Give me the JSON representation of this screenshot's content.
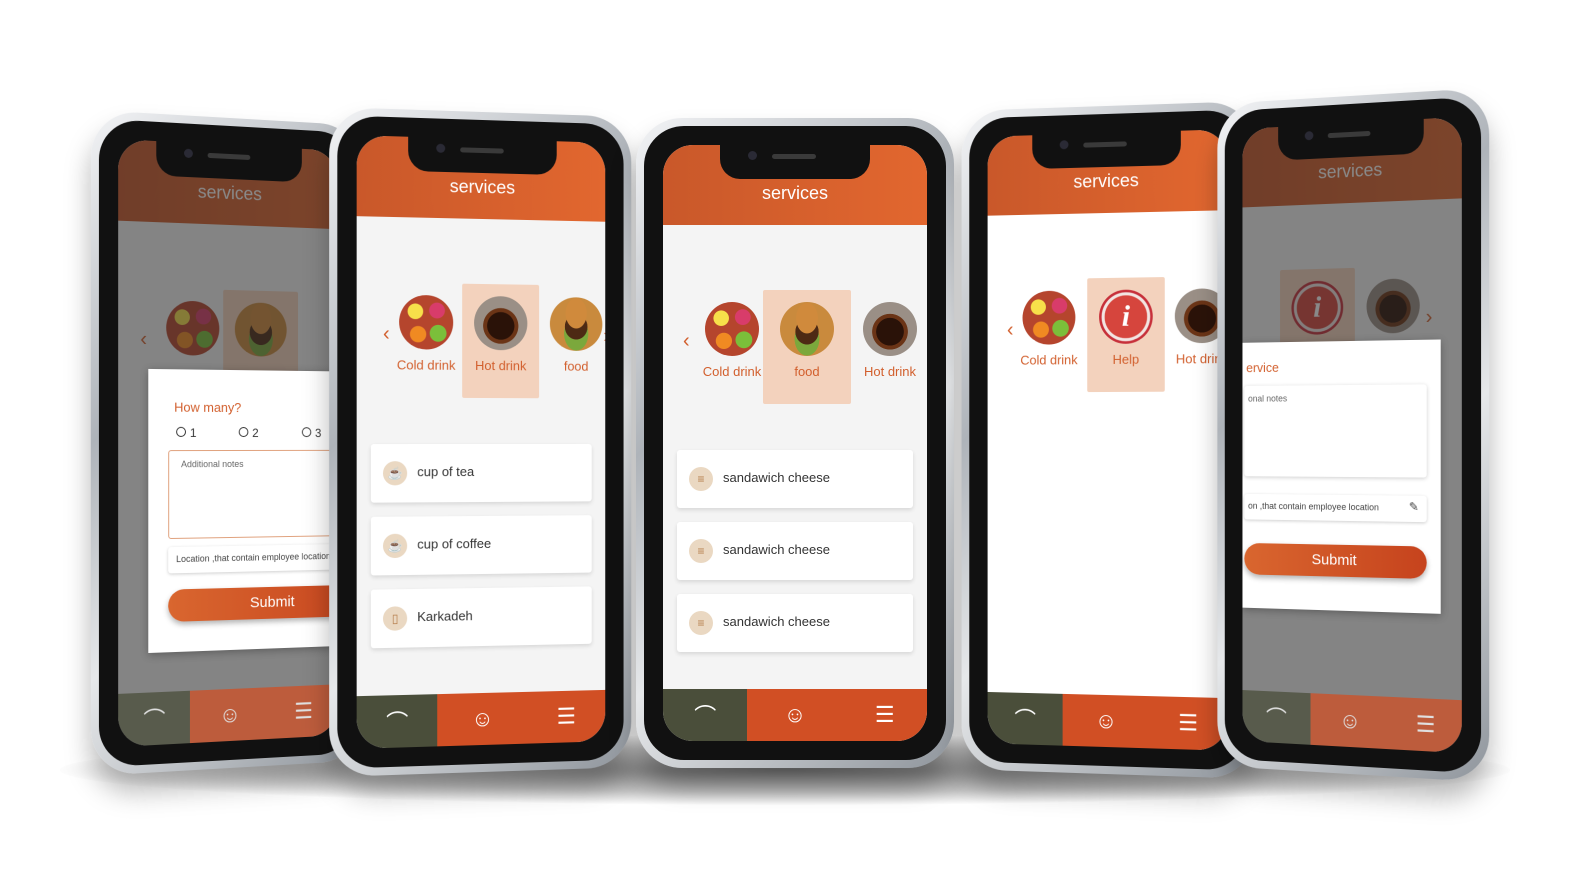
{
  "app": {
    "header_title": "services"
  },
  "nav": {
    "icons": [
      "cloche-icon",
      "user-icon",
      "list-icon"
    ]
  },
  "screen1": {
    "categories": [
      {
        "image": "cold-drink-image"
      },
      {
        "image": "food-image"
      }
    ],
    "dialog": {
      "question": "How many?",
      "options": [
        "1",
        "2",
        "3"
      ],
      "notes_placeholder": "Additional notes",
      "location_value": "Location ,that contain employee location",
      "submit_label": "Submit"
    }
  },
  "screen2": {
    "categories": [
      {
        "label": "Cold drink",
        "image": "cold-drink-image"
      },
      {
        "label": "Hot drink",
        "image": "hot-drink-image",
        "selected": true
      },
      {
        "label": "food",
        "image": "food-image"
      }
    ],
    "items": [
      {
        "label": "cup of tea",
        "icon": "cup-icon"
      },
      {
        "label": "cup of coffee",
        "icon": "coffee-cup-icon"
      },
      {
        "label": "Karkadeh",
        "icon": "glass-icon"
      }
    ]
  },
  "screen3": {
    "categories": [
      {
        "label": "Cold drink",
        "image": "cold-drink-image"
      },
      {
        "label": "food",
        "image": "food-image",
        "selected": true
      },
      {
        "label": "Hot drink",
        "image": "hot-drink-image"
      }
    ],
    "items": [
      {
        "label": "sandawich cheese",
        "icon": "sandwich-icon"
      },
      {
        "label": "sandawich cheese",
        "icon": "sandwich-icon"
      },
      {
        "label": "sandawich cheese",
        "icon": "sandwich-icon"
      }
    ]
  },
  "screen4": {
    "categories": [
      {
        "label": "Cold drink",
        "image": "cold-drink-image"
      },
      {
        "label": "Help",
        "image": "info-image",
        "selected": true
      },
      {
        "label": "Hot drink",
        "image": "hot-drink-image"
      }
    ],
    "help_glyph": "i"
  },
  "screen5": {
    "header_title": "services",
    "dialog_title": "ervice",
    "notes_placeholder": "onal notes",
    "location_value": "on ,that contain employee location",
    "submit_label": "Submit"
  },
  "colors": {
    "accent": "#d25f2d",
    "header": "#e2672f",
    "nav_dark": "#4a4e3a",
    "nav_orange": "#d14f24",
    "selected_bg": "#f3d2bd"
  }
}
